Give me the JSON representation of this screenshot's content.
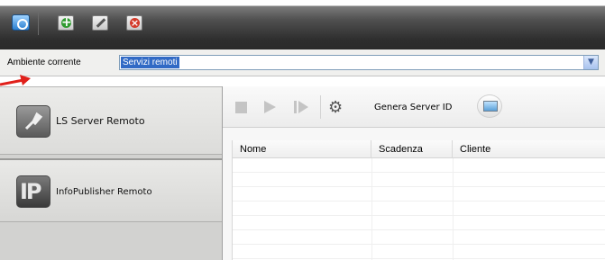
{
  "toolbar": {
    "buttons": [
      {
        "icon": "home-icon"
      },
      {
        "icon": "add-icon"
      },
      {
        "icon": "edit-icon"
      },
      {
        "icon": "delete-icon"
      }
    ]
  },
  "environment": {
    "label": "Ambiente corrente",
    "selected_value": "Servizi remoti"
  },
  "sidebar": {
    "items": [
      {
        "label": "LS Server Remoto",
        "icon": "ls-server-icon"
      },
      {
        "label": "InfoPublisher Remoto",
        "icon": "infopublisher-icon"
      }
    ]
  },
  "actions": {
    "stop": "stop-icon",
    "play": "play-icon",
    "step": "step-forward-icon",
    "settings": "gear-icon",
    "generate_label": "Genera Server ID",
    "monitor": "monitor-icon"
  },
  "table": {
    "columns": [
      "Nome",
      "Scadenza",
      "Cliente"
    ],
    "rows": []
  },
  "colors": {
    "selection_blue": "#316ac5",
    "arrow_red": "#e0201a"
  }
}
